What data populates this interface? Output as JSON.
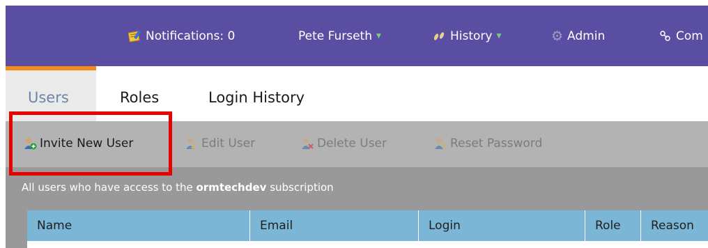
{
  "topbar": {
    "notifications": "Notifications: 0",
    "user": "Pete Furseth",
    "history": "History",
    "admin": "Admin",
    "community": "Com"
  },
  "tabs": [
    {
      "label": "Users",
      "active": true
    },
    {
      "label": "Roles",
      "active": false
    },
    {
      "label": "Login History",
      "active": false
    }
  ],
  "toolbar": {
    "invite": "Invite New User",
    "edit": "Edit User",
    "delete": "Delete User",
    "reset": "Reset Password"
  },
  "description": {
    "prefix": "All users who have access to the ",
    "subscription": "ormtechdev",
    "suffix": " subscription"
  },
  "table": {
    "columns": [
      "Name",
      "Email",
      "Login",
      "Role",
      "Reason"
    ]
  },
  "colors": {
    "topbar": "#5a4ea3",
    "accent": "#f28c16",
    "toolbar": "#b3b3b3",
    "table_header": "#7bb6d6",
    "highlight": "#e60000"
  }
}
